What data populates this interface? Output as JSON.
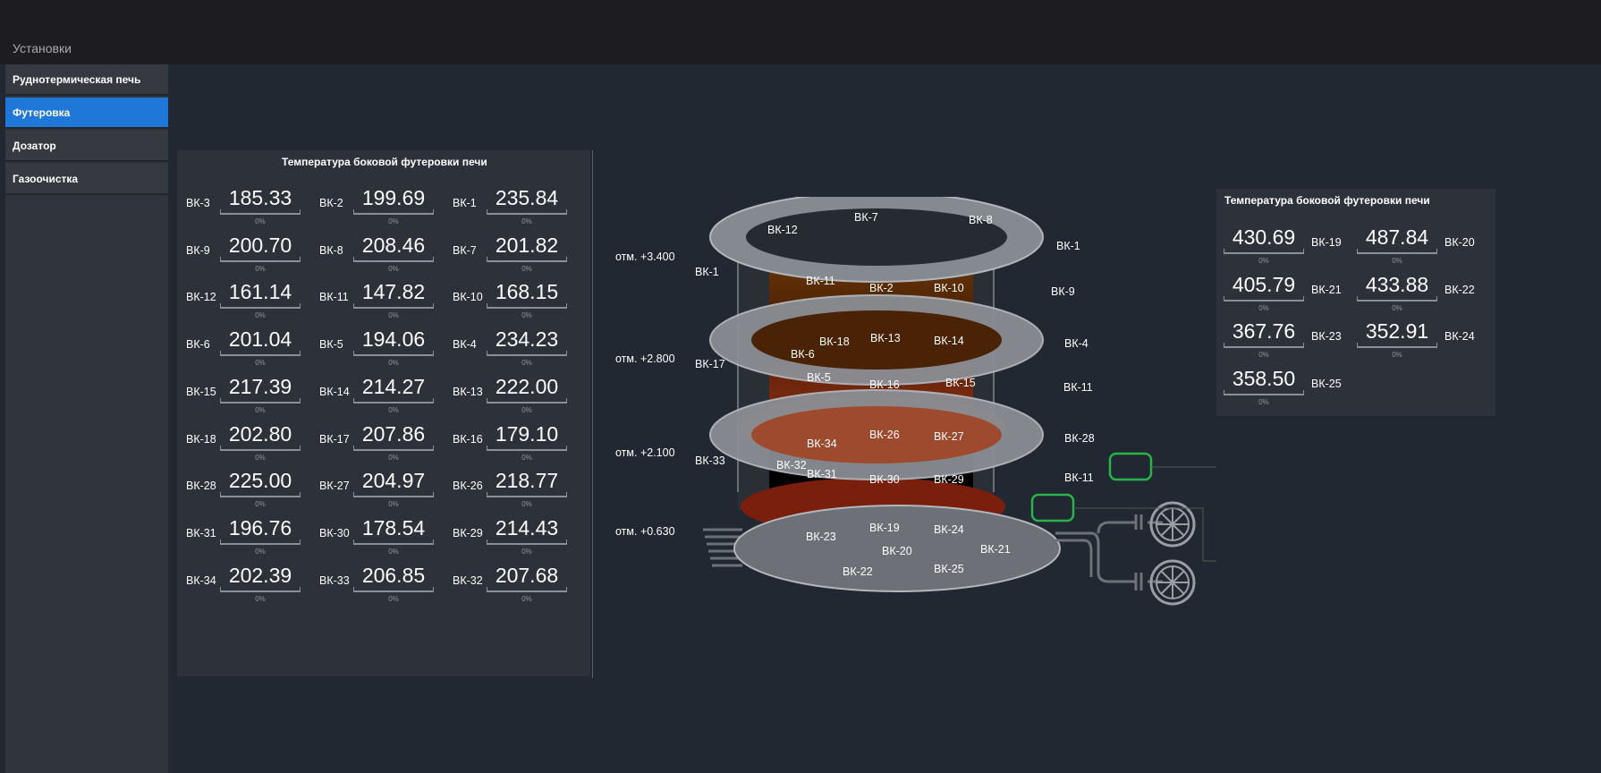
{
  "header": {
    "title": "Установки"
  },
  "sidebar": {
    "items": [
      {
        "label": "Руднотермическая печь"
      },
      {
        "label": "Футеровка"
      },
      {
        "label": "Дозатор"
      },
      {
        "label": "Газоочистка"
      }
    ]
  },
  "left_panel": {
    "title": "Температура боковой футеровки печи",
    "rows": [
      [
        {
          "label": "ВК-3",
          "value": "185.33",
          "pct": "0%"
        },
        {
          "label": "ВК-2",
          "value": "199.69",
          "pct": "0%"
        },
        {
          "label": "ВК-1",
          "value": "235.84",
          "pct": "0%"
        }
      ],
      [
        {
          "label": "ВК-9",
          "value": "200.70",
          "pct": "0%"
        },
        {
          "label": "ВК-8",
          "value": "208.46",
          "pct": "0%"
        },
        {
          "label": "ВК-7",
          "value": "201.82",
          "pct": "0%"
        }
      ],
      [
        {
          "label": "ВК-12",
          "value": "161.14",
          "pct": "0%"
        },
        {
          "label": "ВК-11",
          "value": "147.82",
          "pct": "0%"
        },
        {
          "label": "ВК-10",
          "value": "168.15",
          "pct": "0%"
        }
      ],
      [
        {
          "label": "ВК-6",
          "value": "201.04",
          "pct": "0%"
        },
        {
          "label": "ВК-5",
          "value": "194.06",
          "pct": "0%"
        },
        {
          "label": "ВК-4",
          "value": "234.23",
          "pct": "0%"
        }
      ],
      [
        {
          "label": "ВК-15",
          "value": "217.39",
          "pct": "0%"
        },
        {
          "label": "ВК-14",
          "value": "214.27",
          "pct": "0%"
        },
        {
          "label": "ВК-13",
          "value": "222.00",
          "pct": "0%"
        }
      ],
      [
        {
          "label": "ВК-18",
          "value": "202.80",
          "pct": "0%"
        },
        {
          "label": "ВК-17",
          "value": "207.86",
          "pct": "0%"
        },
        {
          "label": "ВК-16",
          "value": "179.10",
          "pct": "0%"
        }
      ],
      [
        {
          "label": "ВК-28",
          "value": "225.00",
          "pct": "0%"
        },
        {
          "label": "ВК-27",
          "value": "204.97",
          "pct": "0%"
        },
        {
          "label": "ВК-26",
          "value": "218.77",
          "pct": "0%"
        }
      ],
      [
        {
          "label": "ВК-31",
          "value": "196.76",
          "pct": "0%"
        },
        {
          "label": "ВК-30",
          "value": "178.54",
          "pct": "0%"
        },
        {
          "label": "ВК-29",
          "value": "214.43",
          "pct": "0%"
        }
      ],
      [
        {
          "label": "ВК-34",
          "value": "202.39",
          "pct": "0%"
        },
        {
          "label": "ВК-33",
          "value": "206.85",
          "pct": "0%"
        },
        {
          "label": "ВК-32",
          "value": "207.68",
          "pct": "0%"
        }
      ]
    ]
  },
  "right_panel": {
    "title": "Температура боковой футеровки печи",
    "rows": [
      [
        {
          "label": "ВК-19",
          "value": "430.69",
          "pct": "0%"
        },
        {
          "label": "ВК-20",
          "value": "487.84",
          "pct": "0%"
        }
      ],
      [
        {
          "label": "ВК-21",
          "value": "405.79",
          "pct": "0%"
        },
        {
          "label": "ВК-22",
          "value": "433.88",
          "pct": "0%"
        }
      ],
      [
        {
          "label": "ВК-23",
          "value": "367.76",
          "pct": "0%"
        },
        {
          "label": "ВК-24",
          "value": "352.91",
          "pct": "0%"
        }
      ],
      [
        {
          "label": "ВК-25",
          "value": "358.50",
          "pct": "0%"
        }
      ]
    ]
  },
  "diagram": {
    "elevations": [
      "отм. +3.400",
      "отм. +2.800",
      "отм. +2.100",
      "отм. +0.630"
    ],
    "labels": {
      "l1": "ВК-12",
      "l2": "ВК-7",
      "l3": "ВК-8",
      "l4": "ВК-1",
      "l5": "ВК-1",
      "l6": "ВК-11",
      "l7": "ВК-2",
      "l8": "ВК-10",
      "l9": "ВК-9",
      "l10": "ВК-18",
      "l11": "ВК-13",
      "l12": "ВК-14",
      "l13": "ВК-4",
      "l14": "ВК-17",
      "l15": "ВК-6",
      "l16": "ВК-5",
      "l17": "ВК-16",
      "l18": "ВК-15",
      "l19": "ВК-11",
      "l20": "ВК-34",
      "l21": "ВК-26",
      "l22": "ВК-27",
      "l23": "ВК-28",
      "l24": "ВК-33",
      "l25": "ВК-32",
      "l26": "ВК-31",
      "l27": "ВК-30",
      "l28": "ВК-29",
      "l29": "ВК-11",
      "l30": "ВК-23",
      "l31": "ВК-19",
      "l32": "ВК-24",
      "l33": "ВК-20",
      "l34": "ВК-21",
      "l35": "ВК-22",
      "l36": "ВК-25"
    }
  },
  "colors": {
    "accent": "#1f78d8",
    "indicator": "#28b44a",
    "molten": "#b4532a"
  }
}
